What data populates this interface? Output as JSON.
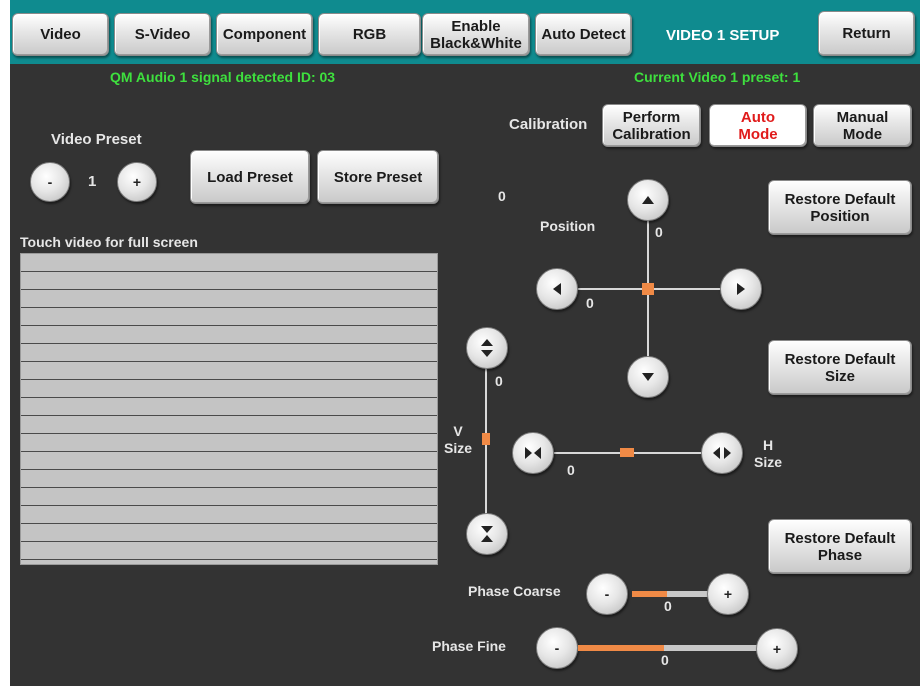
{
  "topbar": {
    "tabs": [
      "Video",
      "S-Video",
      "Component",
      "RGB",
      "Enable\nBlack&White",
      "Auto Detect"
    ],
    "title": "VIDEO 1  SETUP",
    "return_label": "Return",
    "bg_color": "#0f8b8f"
  },
  "status": {
    "signal": "QM Audio 1 signal detected ID:  03",
    "preset": "Current Video 1 preset:  1",
    "color": "#3ee03e"
  },
  "preset": {
    "label": "Video Preset",
    "minus": "-",
    "value": "1",
    "plus": "+",
    "load_label": "Load Preset",
    "store_label": "Store Preset"
  },
  "video": {
    "hint": "Touch video for full screen"
  },
  "calibration": {
    "label": "Calibration",
    "perform_label": "Perform\nCalibration",
    "auto_label": "Auto\nMode",
    "manual_label": "Manual\nMode"
  },
  "position": {
    "label": "Position",
    "readout": "0",
    "v_value": "0",
    "h_value": "0",
    "restore_label": "Restore Default\nPosition"
  },
  "size": {
    "v_label": "V\nSize",
    "h_label": "H\nSize",
    "v_value": "0",
    "h_value": "0",
    "restore_label": "Restore Default\nSize"
  },
  "phase": {
    "restore_label": "Restore Default\nPhase",
    "coarse_label": "Phase Coarse",
    "coarse_minus": "-",
    "coarse_plus": "+",
    "coarse_value": "0",
    "coarse_fill": 0.45,
    "fine_label": "Phase Fine",
    "fine_minus": "-",
    "fine_plus": "+",
    "fine_value": "0",
    "fine_fill": 0.48
  },
  "accent_color": "#f08a46"
}
